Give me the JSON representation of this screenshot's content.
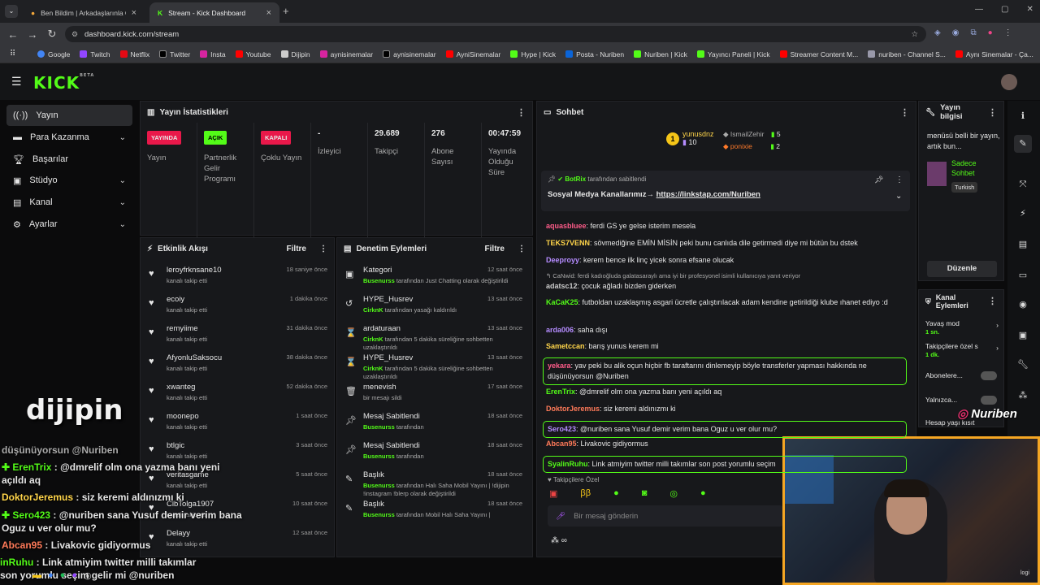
{
  "browser": {
    "tabs": [
      {
        "label": "Ben Bildim | Arkadaşlarınla Onl"
      },
      {
        "label": "Stream - Kick Dashboard"
      }
    ],
    "url": "dashboard.kick.com/stream",
    "bookmarks": [
      "Google",
      "Twitch",
      "Netflix",
      "Twitter",
      "Insta",
      "Youtube",
      "Dijipin",
      "aynisinemalar",
      "aynisinemalar",
      "AyniSinemalar",
      "Hype | Kick",
      "Posta - Nuriben",
      "Nuriben | Kick",
      "Yayıncı Paneli | Kick",
      "Streamer Content M...",
      "nuriben - Channel S...",
      "Aynı Sinemalar - Ça..."
    ]
  },
  "brand": {
    "logo": "KICK",
    "beta": "BETA"
  },
  "nav": [
    {
      "label": "Yayın"
    },
    {
      "label": "Para Kazanma"
    },
    {
      "label": "Başarılar"
    },
    {
      "label": "Stüdyo"
    },
    {
      "label": "Kanal"
    },
    {
      "label": "Ayarlar"
    }
  ],
  "stats": {
    "title": "Yayın İstatistikleri",
    "items": [
      {
        "badge": "YAYINDA",
        "label": "Yayın"
      },
      {
        "badge": "AÇIK",
        "label": "Partnerlik Gelir Programı"
      },
      {
        "badge": "KAPALI",
        "label": "Çoklu Yayın"
      },
      {
        "value": "-",
        "label": "İzleyici"
      },
      {
        "value": "29.689",
        "label": "Takipçi"
      },
      {
        "value": "276",
        "label": "Abone Sayısı"
      },
      {
        "value": "00:47:59",
        "label": "Yayında Olduğu Süre"
      }
    ]
  },
  "activity": {
    "title": "Etkinlik Akışı",
    "filter": "Filtre",
    "events": [
      {
        "name": "leroyfrknsane10",
        "sub": "kanalı takip etti",
        "time": "18 saniye önce"
      },
      {
        "name": "ecoiy",
        "sub": "kanalı takip etti",
        "time": "1 dakika önce"
      },
      {
        "name": "remyiime",
        "sub": "kanalı takip etti",
        "time": "31 dakika önce"
      },
      {
        "name": "AfyonluSaksocu",
        "sub": "kanalı takip etti",
        "time": "38 dakika önce"
      },
      {
        "name": "xwanteg",
        "sub": "kanalı takip etti",
        "time": "52 dakika önce"
      },
      {
        "name": "moonepo",
        "sub": "kanalı takip etti",
        "time": "1 saat önce"
      },
      {
        "name": "btlgic",
        "sub": "kanalı takip etti",
        "time": "3 saat önce"
      },
      {
        "name": "veritasgame",
        "sub": "kanalı takip etti",
        "time": "5 saat önce"
      },
      {
        "name": "ClbTolga1907",
        "sub": "kanalı takip etti",
        "time": "10 saat önce"
      },
      {
        "name": "Delayy",
        "sub": "kanalı takip etti",
        "time": "12 saat önce"
      }
    ]
  },
  "mod": {
    "title": "Denetim Eylemleri",
    "filter": "Filtre",
    "actions": [
      {
        "name": "Kategori",
        "user": "Busenurss",
        "sub": " tarafından Just Chatting olarak değiştirildi",
        "time": "12 saat önce"
      },
      {
        "name": "HYPE_Husrev",
        "user": "CirknK",
        "sub": " tarafından yasağı kaldırıldı",
        "time": "13 saat önce"
      },
      {
        "name": "ardaturaan",
        "user": "CirknK",
        "sub": " tarafından 5 dakika süreliğine sohbetten uzaklaştırıldı",
        "time": "13 saat önce"
      },
      {
        "name": "HYPE_Husrev",
        "user": "CirknK",
        "sub": " tarafından 5 dakika süreliğine sohbetten uzaklaştırıldı",
        "time": "13 saat önce"
      },
      {
        "name": "menevish",
        "user": "",
        "sub": "bir mesajı sildi",
        "time": "17 saat önce"
      },
      {
        "name": "Mesaj Sabitlendi",
        "user": "Busenurss",
        "sub": " tarafından",
        "time": "18 saat önce"
      },
      {
        "name": "Mesaj Sabitlendi",
        "user": "Busenurss",
        "sub": " tarafından",
        "time": "18 saat önce"
      },
      {
        "name": "Başlık",
        "user": "Busenurss",
        "sub": " tarafından Halı Saha Mobil Yayını | !dijipin !instagram !blerp olarak değiştirildi",
        "time": "18 saat önce"
      },
      {
        "name": "Başlık",
        "user": "Busenurss",
        "sub": " tarafından Mobil Halı Saha Yayını |",
        "time": "18 saat önce"
      }
    ]
  },
  "chat": {
    "title": "Sohbet",
    "top1": {
      "name": "yunusdnz",
      "count": "10"
    },
    "top2": {
      "name": "IsmailZehir",
      "count": "5"
    },
    "top3": {
      "name": "ponixie",
      "count": "2"
    },
    "pinned": {
      "by": "BotRix",
      "by_suffix": "tarafından sabitlendi",
      "text": "Sosyal Medya Kanallarımız→ ",
      "link": "https://linkstap.com/Nuriben"
    },
    "messages": [
      {
        "user": "aquasbluee",
        "text": "ferdi GS ye gelse isterim mesela",
        "color": "#ff5c8a"
      },
      {
        "user": "TEKS7VENN",
        "text": "sövmediğine EMİN MİSİN peki bunu canlıda dile getirmedi diye mi bütün bu dstek",
        "color": "#ffd54a"
      },
      {
        "user": "Deeproyy",
        "text": "kerem bence ilk linç yicek sonra efsane olucak",
        "color": "#b58cff"
      },
      {
        "user": "",
        "text": "CaNwid: ferdi kadıoğluda galatasaraylı ama iyi bir profesyonel isimli kullanıcıya yanıt veriyor",
        "color": "#aaaaaa"
      },
      {
        "user": "adatsc12",
        "text": "çocuk ağladı bizden giderken",
        "color": "#cccccc"
      },
      {
        "user": "KaCaK25",
        "text": "futboldan uzaklaşmış asgari ücretle çalıştırılacak adam kendine getirildiği klube ıhanet ediyo :d",
        "color": "#53fc18"
      },
      {
        "user": "arda006",
        "text": "saha dışı",
        "color": "#b58cff"
      },
      {
        "user": "Sametccan",
        "text": "barış yunus kerem mi",
        "color": "#ffd54a"
      },
      {
        "user": "yekara",
        "text": "yav peki bu alik oçun hiçbir fb taraftarını dinlemeyip böyle transferler yapması hakkında ne düşünüyorsun @Nuriben",
        "color": "#ff5c8a"
      },
      {
        "user": "ErenTrix",
        "text": "@dmrelif olm ona yazma banı yeni açıldı aq",
        "color": "#53fc18"
      },
      {
        "user": "DoktorJeremus",
        "text": "siz keremi aldınızmı ki",
        "color": "#ff7a59"
      },
      {
        "user": "Sero423",
        "text": "@nuriben sana Yusuf demir verim bana Oguz u ver olur mu?",
        "color": "#b58cff"
      },
      {
        "user": "Abcan95",
        "text": "Livakovic gidiyormus",
        "color": "#ff7a59"
      },
      {
        "user": "SyalinRuhu",
        "text": "Link atmiyim twitter milli takımlar son post yorumlu seçim",
        "color": "#53fc18"
      }
    ],
    "followers_only": "Takipçilere Özel",
    "placeholder": "Bir mesaj gönderin"
  },
  "info": {
    "title": "Yayın bilgisi",
    "desc": "menüsü belli bir yayın, artık bun...",
    "mode": "Sadece Sohbet",
    "lang": "Turkish",
    "edit": "Düzenle"
  },
  "channel": {
    "title": "Kanal Eylemleri",
    "slow": "Yavaş mod",
    "slow_val": "1 sn.",
    "follow": "Takipçilere özel s",
    "follow_val": "1 dk.",
    "subs": "Abonelere...",
    "only": "Yalnızca...",
    "age": "Hesap yaşı kısıt"
  },
  "overlay": {
    "brand": "dijipin",
    "chat_lines": [
      "düşünüyorsun @Nuriben",
      "ErenTrix : @dmrelif olm ona yazma banı yeni açıldı aq",
      "DoktorJeremus : siz keremi aldınızmı ki",
      "Sero423 : @nuriben sana Yusuf demir verim bana Oguz u ver olur mu?",
      "Abcan95 : Livakovic gidiyormus",
      "inRuhu : Link atmiyim twitter milli takımlar son yorumlu seçim gelir mi @nuriben"
    ],
    "insta": "Nuriben",
    "cam_tag": "logi"
  }
}
